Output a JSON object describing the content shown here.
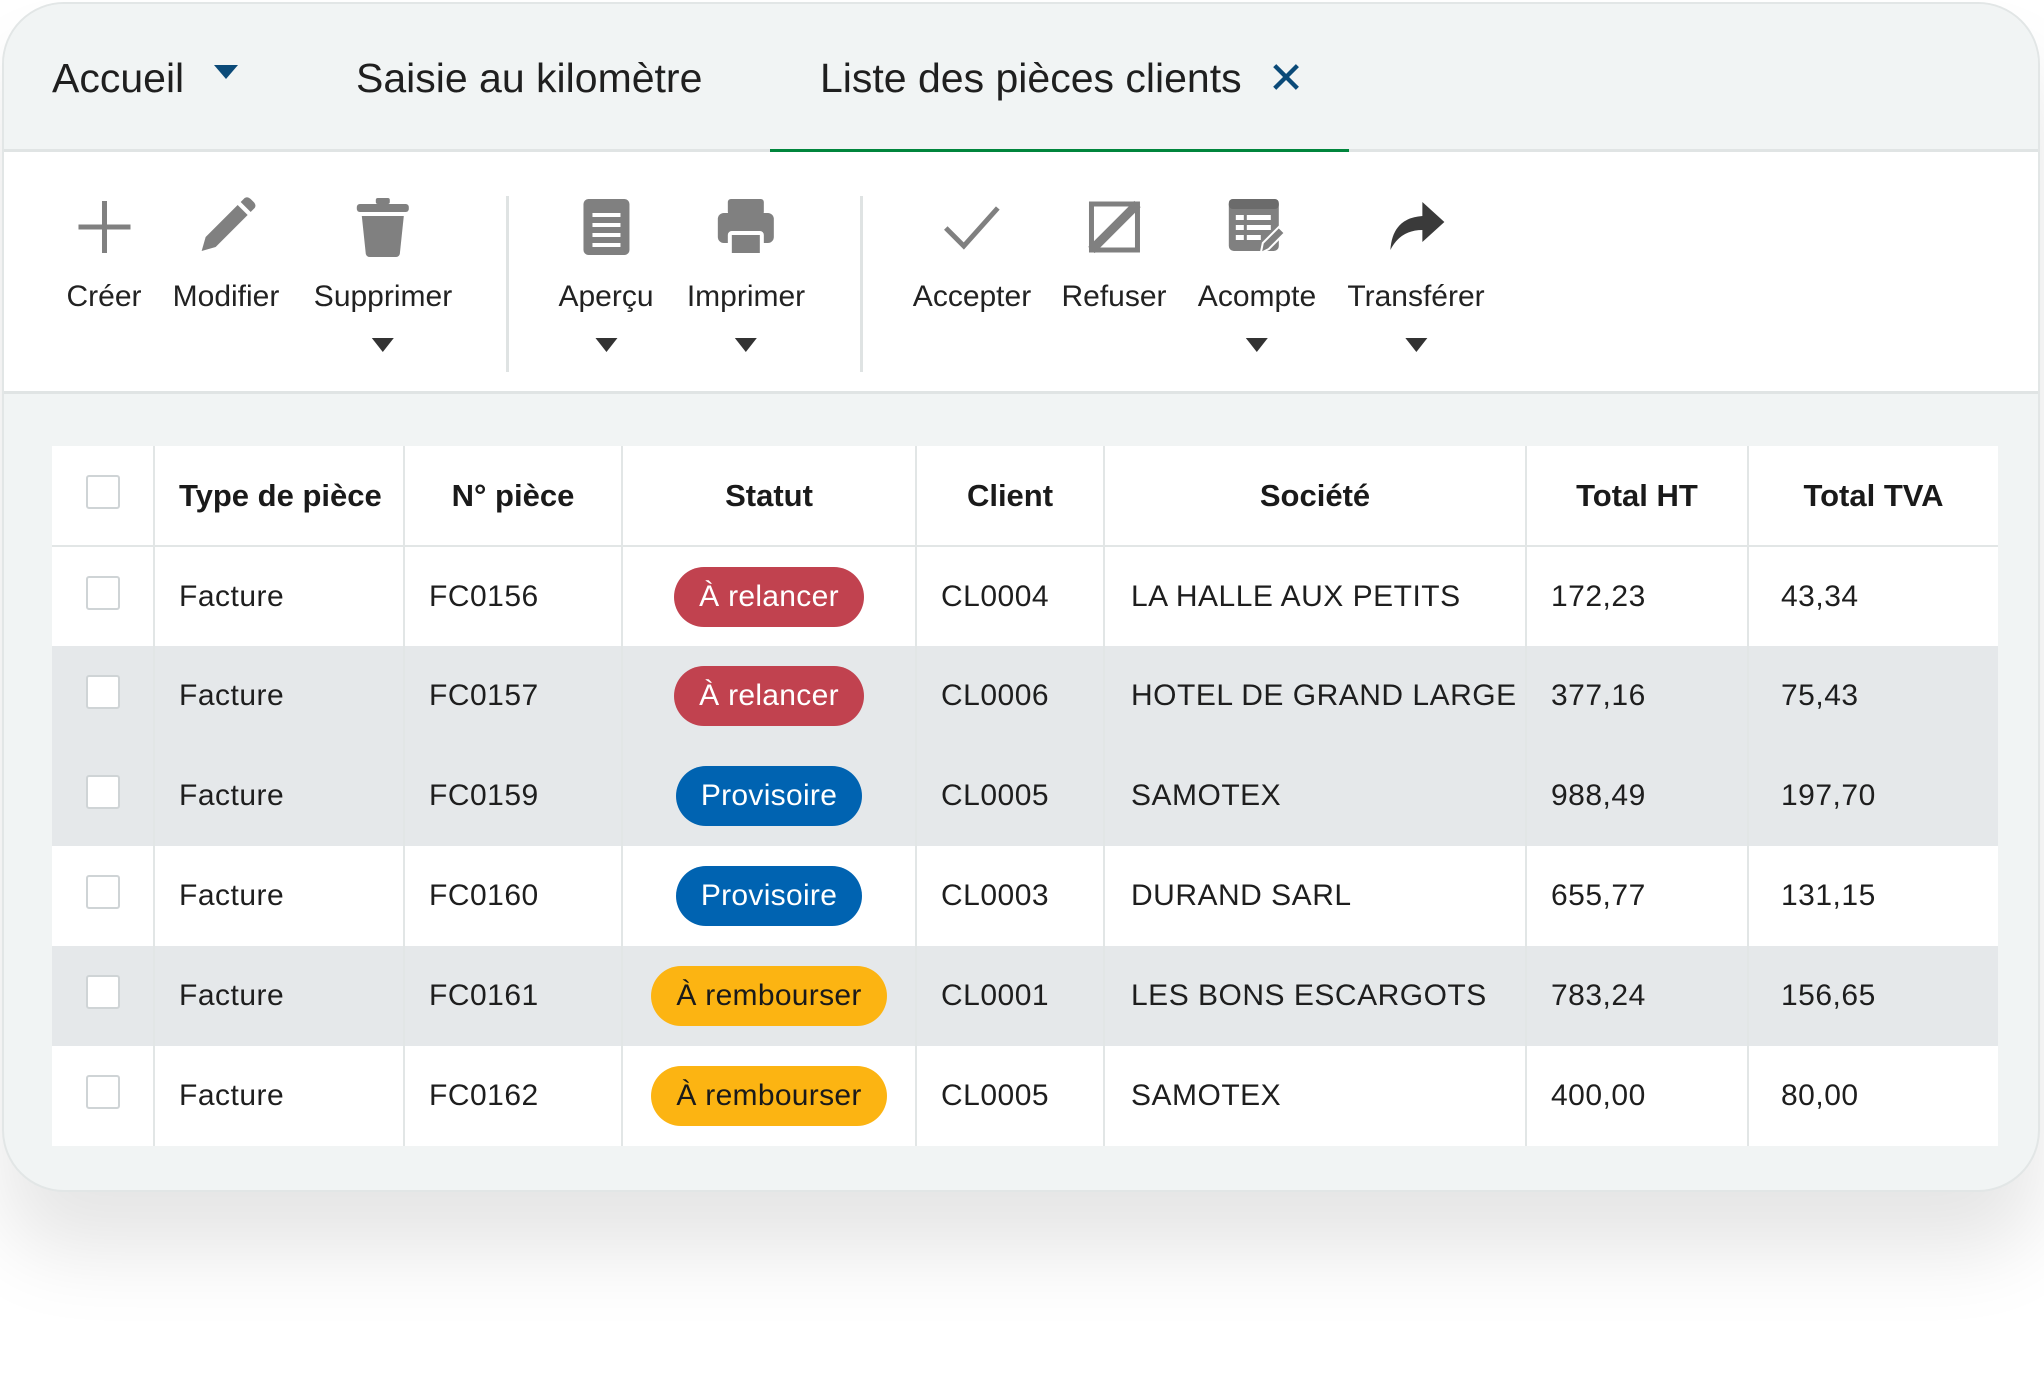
{
  "tabs": [
    {
      "label": "Accueil",
      "has_dropdown": true
    },
    {
      "label": "Saisie au kilomètre"
    },
    {
      "label": "Liste des pièces clients",
      "active": true,
      "closable": true
    }
  ],
  "toolbar": {
    "creer": "Créer",
    "modifier": "Modifier",
    "supprimer": "Supprimer",
    "apercu": "Aperçu",
    "imprimer": "Imprimer",
    "accepter": "Accepter",
    "refuser": "Refuser",
    "acompte": "Acompte",
    "transferer": "Transférer"
  },
  "table": {
    "headers": [
      "Type de pièce",
      "N° pièce",
      "Statut",
      "Client",
      "Société",
      "Total HT",
      "Total TVA"
    ],
    "rows": [
      {
        "type": "Facture",
        "num": "FC0156",
        "status": "À relancer",
        "client": "CL0004",
        "societe": "LA HALLE AUX PETITS",
        "ht": "172,23",
        "tva": "43,34"
      },
      {
        "type": "Facture",
        "num": "FC0157",
        "status": "À relancer",
        "client": "CL0006",
        "societe": "HOTEL DE GRAND LARGE",
        "ht": "377,16",
        "tva": "75,43"
      },
      {
        "type": "Facture",
        "num": "FC0159",
        "status": "Provisoire",
        "client": "CL0005",
        "societe": "SAMOTEX",
        "ht": "988,49",
        "tva": "197,70"
      },
      {
        "type": "Facture",
        "num": "FC0160",
        "status": "Provisoire",
        "client": "CL0003",
        "societe": "DURAND SARL",
        "ht": "655,77",
        "tva": "131,15"
      },
      {
        "type": "Facture",
        "num": "FC0161",
        "status": "À rembourser",
        "client": "CL0001",
        "societe": "LES BONS ESCARGOTS",
        "ht": "783,24",
        "tva": "156,65"
      },
      {
        "type": "Facture",
        "num": "FC0162",
        "status": "À rembourser",
        "client": "CL0005",
        "societe": "SAMOTEX",
        "ht": "400,00",
        "tva": "80,00"
      }
    ]
  },
  "status_colors": {
    "À relancer": {
      "bg": "#c1424f",
      "fg": "#ffffff"
    },
    "Provisoire": {
      "bg": "#0063b1",
      "fg": "#ffffff"
    },
    "À rembourser": {
      "bg": "#fcb412",
      "fg": "#1a1a1a"
    }
  },
  "colors": {
    "accent_tab": "#00853c",
    "icon_gray": "#808080",
    "close_x": "#0b4a78"
  }
}
